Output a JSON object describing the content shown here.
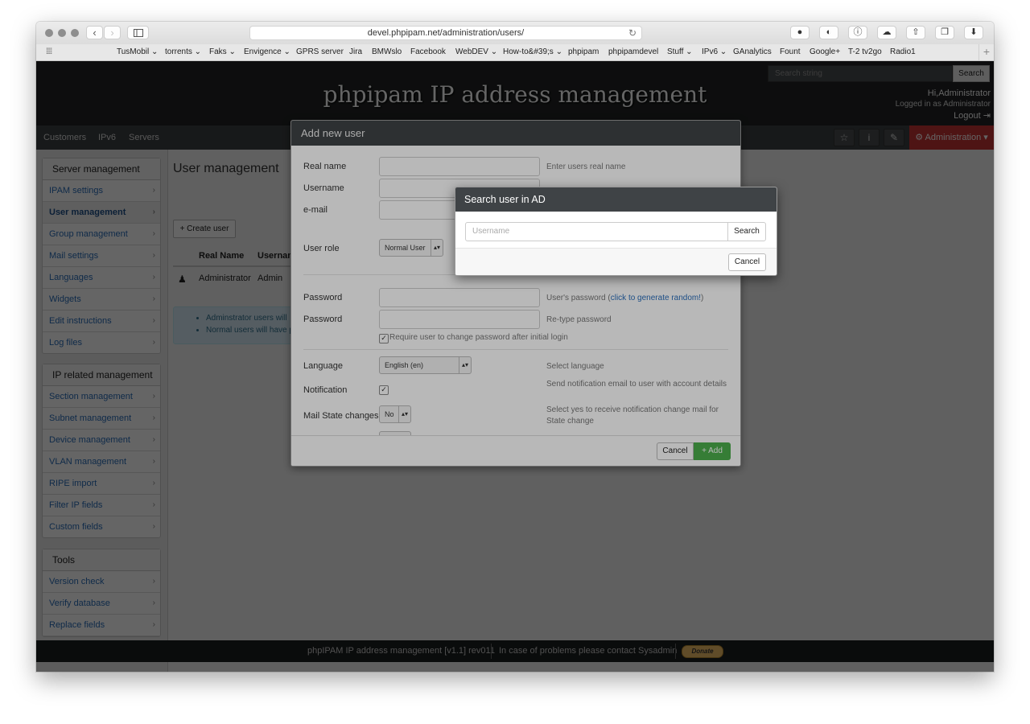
{
  "browser": {
    "url": "devel.phpipam.net/administration/users/",
    "back_icon": "‹",
    "forward_icon": "›",
    "reload_icon": "↻",
    "bookmarks": [
      "TusMobil ⌄",
      "torrents ⌄",
      "Faks ⌄",
      "Envigence ⌄",
      "GPRS server",
      "Jira",
      "BMWslo",
      "Facebook",
      "WebDEV ⌄",
      "How-to&#39;s ⌄",
      "phpipam",
      "phpipamdevel",
      "Stuff ⌄",
      "IPv6 ⌄",
      "GAnalytics",
      "Fount",
      "Google+",
      "T-2 tv2go",
      "Radio1"
    ]
  },
  "header": {
    "title": "phpipam IP address management",
    "search_placeholder": "Search string",
    "search_button": "Search",
    "user_greeting": "Hi,Administrator",
    "logged_in": "Logged in as Administrator",
    "logout": "Logout"
  },
  "navbar": {
    "links": [
      "Customers",
      "IPv6",
      "Servers"
    ],
    "admin_label": "⚙ Administration ▾"
  },
  "sidebar": {
    "server_title": "Server management",
    "server_items": [
      "IPAM settings",
      "User management",
      "Group management",
      "Mail settings",
      "Languages",
      "Widgets",
      "Edit instructions",
      "Log files"
    ],
    "ip_title": "IP related management",
    "ip_items": [
      "Section management",
      "Subnet management",
      "Device management",
      "VLAN management",
      "RIPE import",
      "Filter IP fields",
      "Custom fields"
    ],
    "tools_title": "Tools",
    "tools_items": [
      "Version check",
      "Verify database",
      "Replace fields"
    ]
  },
  "main": {
    "title": "User management",
    "create_button": "+ Create user",
    "col_realname": "Real Name",
    "col_username": "Usernan",
    "row_realname": "Administrator",
    "row_username": "Admin",
    "info_1": "Adminstrator users will",
    "info_2": "Normal users will have p"
  },
  "add_user_modal": {
    "title": "Add new user",
    "real_name_label": "Real name",
    "real_name_help": "Enter users real name",
    "username_label": "Username",
    "email_label": "e-mail",
    "role_label": "User role",
    "role_value": "Normal User",
    "password_label": "Password",
    "password_help_1": "User's password (",
    "password_help_link": "click to generate random!",
    "password_help_2": ")",
    "password2_label": "Password",
    "password2_help": "Re-type password",
    "require_change": "Require user to change password after initial login",
    "language_label": "Language",
    "language_value": "English (en)",
    "language_help": "Select language",
    "notification_label": "Notification",
    "notification_help": "Send notification email to user with account details",
    "mail_state_label": "Mail State changes",
    "mail_state_value": "No",
    "mail_state_help": "Select yes to receive notification change mail for State change",
    "cancel": "Cancel",
    "add": "+ Add"
  },
  "search_modal": {
    "title": "Search user in AD",
    "placeholder": "Username",
    "search_button": "Search",
    "cancel": "Cancel"
  },
  "footer": {
    "version": "phpIPAM IP address management [v1.1] rev011",
    "contact": "In case of problems please contact Sysadmin",
    "donate": "Donate"
  }
}
